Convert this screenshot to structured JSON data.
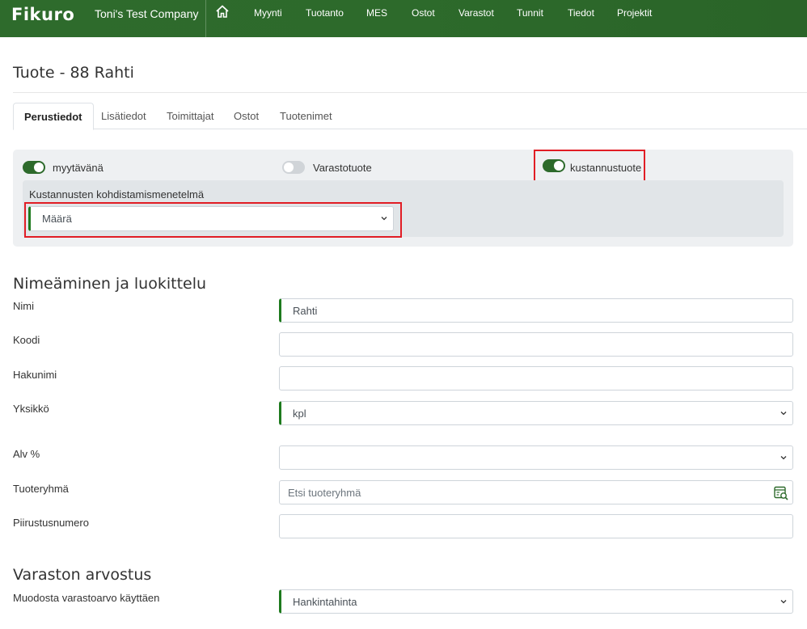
{
  "header": {
    "brand": "Fikuro",
    "company": "Toni's Test Company",
    "nav": [
      "Myynti",
      "Tuotanto",
      "MES",
      "Ostot",
      "Varastot",
      "Tunnit",
      "Tiedot",
      "Projektit"
    ]
  },
  "page": {
    "title": "Tuote - 88 Rahti"
  },
  "tabs": [
    "Perustiedot",
    "Lisätiedot",
    "Toimittajat",
    "Ostot",
    "Tuotenimet"
  ],
  "settings": {
    "toggles": [
      {
        "label": "myytävänä",
        "on": true
      },
      {
        "label": "Varastotuote",
        "on": false
      },
      {
        "label": "kustannustuote",
        "on": true
      }
    ],
    "allocation_label": "Kustannusten kohdistamismenetelmä",
    "allocation_value": "Määrä"
  },
  "naming": {
    "title": "Nimeäminen ja luokittelu",
    "name_label": "Nimi",
    "name_value": "Rahti",
    "code_label": "Koodi",
    "search_name_label": "Hakunimi",
    "unit_label": "Yksikkö",
    "unit_value": "kpl",
    "vat_label": "Alv %",
    "group_label": "Tuoteryhmä",
    "group_placeholder": "Etsi tuoteryhmä",
    "drawing_label": "Piirustusnumero"
  },
  "valuation": {
    "title": "Varaston arvostus",
    "method_label": "Muodosta varastoarvo käyttäen",
    "method_value": "Hankintahinta"
  },
  "colors": {
    "brand_green": "#2d6a2b",
    "required_marker": "#1e7a1e",
    "highlight_red": "#e11d25"
  }
}
